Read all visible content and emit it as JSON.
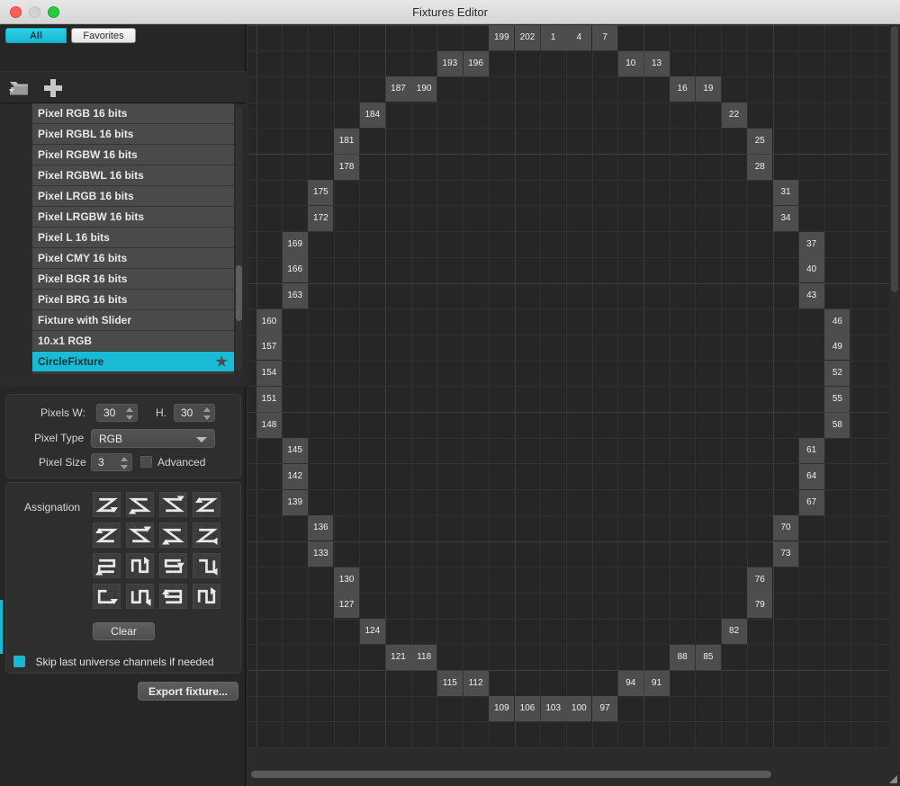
{
  "window": {
    "title": "Fixtures Editor",
    "traffic_lights": [
      "close",
      "minimize",
      "zoom"
    ]
  },
  "sidebar": {
    "segmented": {
      "all": "All",
      "favorites": "Favorites",
      "active": "All"
    },
    "toolbar": {
      "new_folder_icon": "folder-add-icon",
      "add_icon": "plus-icon"
    },
    "fixtures": [
      {
        "label": "Pixel RGB 16 bits",
        "selected": false,
        "favorite": false
      },
      {
        "label": "Pixel RGBL 16 bits",
        "selected": false,
        "favorite": false
      },
      {
        "label": "Pixel RGBW 16 bits",
        "selected": false,
        "favorite": false
      },
      {
        "label": "Pixel RGBWL 16 bits",
        "selected": false,
        "favorite": false
      },
      {
        "label": "Pixel LRGB 16 bits",
        "selected": false,
        "favorite": false
      },
      {
        "label": "Pixel LRGBW 16 bits",
        "selected": false,
        "favorite": false
      },
      {
        "label": "Pixel L 16 bits",
        "selected": false,
        "favorite": false
      },
      {
        "label": "Pixel CMY 16 bits",
        "selected": false,
        "favorite": false
      },
      {
        "label": "Pixel BGR 16 bits",
        "selected": false,
        "favorite": false
      },
      {
        "label": "Pixel BRG 16 bits",
        "selected": false,
        "favorite": false
      },
      {
        "label": "Fixture with Slider",
        "selected": false,
        "favorite": false
      },
      {
        "label": "10.x1 RGB",
        "selected": false,
        "favorite": false
      },
      {
        "label": "CircleFixture",
        "selected": true,
        "favorite": true
      }
    ]
  },
  "params": {
    "pixels_w_label": "Pixels W:",
    "pixels_w_value": "30",
    "pixels_h_label": "H.",
    "pixels_h_value": "30",
    "pixel_type_label": "Pixel Type",
    "pixel_type_value": "RGB",
    "pixel_type_options": [
      "RGB"
    ],
    "pixel_size_label": "Pixel Size",
    "pixel_size_value": "3",
    "advanced_label": "Advanced",
    "advanced_checked": false
  },
  "assignation": {
    "label": "Assignation",
    "patterns": [
      "zigzag-right-down",
      "zigzag-left-down",
      "zigzag-right-up-mirror",
      "zigzag-left-up-mirror",
      "zigzag-right-up",
      "zigzag-left-up",
      "zigzag-right-down-mirror",
      "zigzag-left-down-mirror",
      "serpentine-top-left",
      "serpentine-bottom-up",
      "serpentine-top-right",
      "serpentine-top-down",
      "serpentine-left-right",
      "serpentine-down",
      "serpentine-left-up",
      "serpentine-up"
    ],
    "clear_label": "Clear",
    "skip_label": "Skip last universe channels if needed",
    "skip_checked": true
  },
  "export": {
    "label": "Export fixture..."
  },
  "grid": {
    "cols": 25,
    "rows": 28,
    "cell_size": 28.7,
    "accent_color": "#19b9d4",
    "cell_bg": "#4d4d4d",
    "cells": [
      {
        "c": 9,
        "r": 0,
        "v": "199"
      },
      {
        "c": 10,
        "r": 0,
        "v": "202"
      },
      {
        "c": 11,
        "r": 0,
        "v": "1"
      },
      {
        "c": 12,
        "r": 0,
        "v": "4"
      },
      {
        "c": 13,
        "r": 0,
        "v": "7"
      },
      {
        "c": 7,
        "r": 1,
        "v": "193"
      },
      {
        "c": 8,
        "r": 1,
        "v": "196"
      },
      {
        "c": 14,
        "r": 1,
        "v": "10"
      },
      {
        "c": 15,
        "r": 1,
        "v": "13"
      },
      {
        "c": 5,
        "r": 2,
        "v": "187"
      },
      {
        "c": 6,
        "r": 2,
        "v": "190"
      },
      {
        "c": 16,
        "r": 2,
        "v": "16"
      },
      {
        "c": 17,
        "r": 2,
        "v": "19"
      },
      {
        "c": 4,
        "r": 3,
        "v": "184"
      },
      {
        "c": 18,
        "r": 3,
        "v": "22"
      },
      {
        "c": 3,
        "r": 4,
        "v": "181"
      },
      {
        "c": 19,
        "r": 4,
        "v": "25"
      },
      {
        "c": 3,
        "r": 5,
        "v": "178"
      },
      {
        "c": 19,
        "r": 5,
        "v": "28"
      },
      {
        "c": 2,
        "r": 6,
        "v": "175"
      },
      {
        "c": 20,
        "r": 6,
        "v": "31"
      },
      {
        "c": 2,
        "r": 7,
        "v": "172"
      },
      {
        "c": 20,
        "r": 7,
        "v": "34"
      },
      {
        "c": 1,
        "r": 8,
        "v": "169"
      },
      {
        "c": 21,
        "r": 8,
        "v": "37"
      },
      {
        "c": 1,
        "r": 9,
        "v": "166"
      },
      {
        "c": 21,
        "r": 9,
        "v": "40"
      },
      {
        "c": 1,
        "r": 10,
        "v": "163"
      },
      {
        "c": 21,
        "r": 10,
        "v": "43"
      },
      {
        "c": 0,
        "r": 11,
        "v": "160"
      },
      {
        "c": 22,
        "r": 11,
        "v": "46"
      },
      {
        "c": 0,
        "r": 12,
        "v": "157"
      },
      {
        "c": 22,
        "r": 12,
        "v": "49"
      },
      {
        "c": 0,
        "r": 13,
        "v": "154"
      },
      {
        "c": 22,
        "r": 13,
        "v": "52"
      },
      {
        "c": 0,
        "r": 14,
        "v": "151"
      },
      {
        "c": 22,
        "r": 14,
        "v": "55"
      },
      {
        "c": 0,
        "r": 15,
        "v": "148"
      },
      {
        "c": 22,
        "r": 15,
        "v": "58"
      },
      {
        "c": 1,
        "r": 16,
        "v": "145"
      },
      {
        "c": 21,
        "r": 16,
        "v": "61"
      },
      {
        "c": 1,
        "r": 17,
        "v": "142"
      },
      {
        "c": 21,
        "r": 17,
        "v": "64"
      },
      {
        "c": 1,
        "r": 18,
        "v": "139"
      },
      {
        "c": 21,
        "r": 18,
        "v": "67"
      },
      {
        "c": 2,
        "r": 19,
        "v": "136"
      },
      {
        "c": 20,
        "r": 19,
        "v": "70"
      },
      {
        "c": 2,
        "r": 20,
        "v": "133"
      },
      {
        "c": 20,
        "r": 20,
        "v": "73"
      },
      {
        "c": 3,
        "r": 21,
        "v": "130"
      },
      {
        "c": 19,
        "r": 21,
        "v": "76"
      },
      {
        "c": 3,
        "r": 22,
        "v": "127"
      },
      {
        "c": 19,
        "r": 22,
        "v": "79"
      },
      {
        "c": 4,
        "r": 23,
        "v": "124"
      },
      {
        "c": 18,
        "r": 23,
        "v": "82"
      },
      {
        "c": 5,
        "r": 24,
        "v": "121"
      },
      {
        "c": 6,
        "r": 24,
        "v": "118"
      },
      {
        "c": 16,
        "r": 24,
        "v": "88"
      },
      {
        "c": 17,
        "r": 24,
        "v": "85"
      },
      {
        "c": 7,
        "r": 25,
        "v": "115"
      },
      {
        "c": 8,
        "r": 25,
        "v": "112"
      },
      {
        "c": 14,
        "r": 25,
        "v": "94"
      },
      {
        "c": 15,
        "r": 25,
        "v": "91"
      },
      {
        "c": 9,
        "r": 26,
        "v": "109"
      },
      {
        "c": 10,
        "r": 26,
        "v": "106"
      },
      {
        "c": 11,
        "r": 26,
        "v": "103"
      },
      {
        "c": 12,
        "r": 26,
        "v": "100"
      },
      {
        "c": 13,
        "r": 26,
        "v": "97"
      }
    ]
  }
}
